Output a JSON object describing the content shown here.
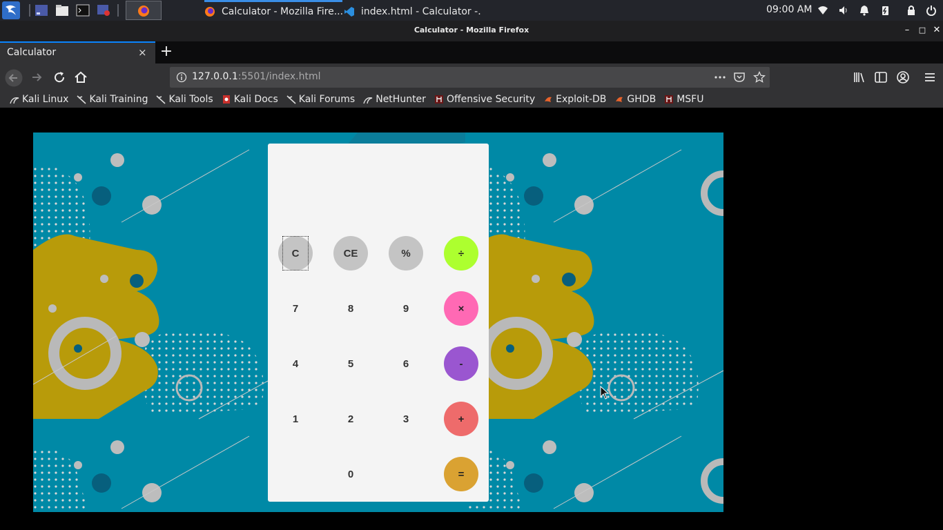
{
  "os_panel": {
    "taskbar": [
      {
        "title": "Calculator - Mozilla Fire...",
        "active": true
      },
      {
        "title": "index.html - Calculator -...",
        "active": false
      }
    ],
    "clock": "09:00 AM"
  },
  "window": {
    "title": "Calculator - Mozilla Firefox"
  },
  "browser": {
    "tab": {
      "title": "Calculator",
      "close": "×"
    },
    "new_tab": "+",
    "url": {
      "host": "127.0.0.1",
      "rest": ":5501/index.html"
    },
    "bookmarks": [
      {
        "label": "Kali Linux",
        "icon": "kali-dragon-icon"
      },
      {
        "label": "Kali Training",
        "icon": "kali-dragon-icon"
      },
      {
        "label": "Kali Tools",
        "icon": "kali-dragon-icon"
      },
      {
        "label": "Kali Docs",
        "icon": "kali-docs-icon"
      },
      {
        "label": "Kali Forums",
        "icon": "kali-dragon-icon"
      },
      {
        "label": "NetHunter",
        "icon": "nethunter-icon"
      },
      {
        "label": "Offensive Security",
        "icon": "offsec-icon"
      },
      {
        "label": "Exploit-DB",
        "icon": "exploitdb-icon"
      },
      {
        "label": "GHDB",
        "icon": "exploitdb-icon"
      },
      {
        "label": "MSFU",
        "icon": "offsec-icon"
      }
    ]
  },
  "calculator": {
    "display": "",
    "keys": {
      "clear": "C",
      "clear_entry": "CE",
      "percent": "%",
      "divide": "÷",
      "seven": "7",
      "eight": "8",
      "nine": "9",
      "multiply": "×",
      "four": "4",
      "five": "5",
      "six": "6",
      "subtract": "-",
      "one": "1",
      "two": "2",
      "three": "3",
      "add": "+",
      "zero": "0",
      "equals": "="
    },
    "colors": {
      "divide": "#adff2f",
      "multiply": "#ff69b4",
      "subtract": "#9a56d0",
      "add": "#ee6b6b",
      "equals": "#daa232",
      "neutral": "#c4c4c4"
    }
  }
}
